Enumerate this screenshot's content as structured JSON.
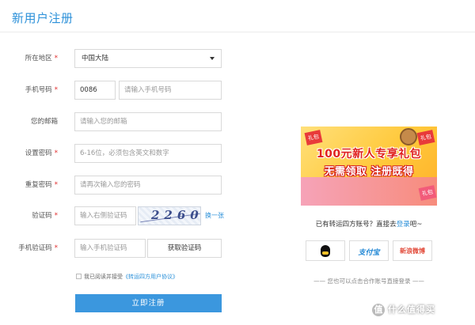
{
  "page": {
    "title": "新用户注册"
  },
  "form": {
    "region": {
      "label": "所在地区",
      "value": "中国大陆"
    },
    "phone": {
      "label": "手机号码",
      "code": "0086",
      "placeholder": "请输入手机号码"
    },
    "email": {
      "label": "您的邮箱",
      "placeholder": "请输入您的邮箱"
    },
    "password": {
      "label": "设置密码",
      "placeholder": "6-16位，必须包含英文和数字"
    },
    "repeat_password": {
      "label": "重复密码",
      "placeholder": "请再次输入您的密码"
    },
    "captcha": {
      "label": "验证码",
      "placeholder": "输入右侧验证码",
      "image_text": "2260",
      "refresh": "换一张"
    },
    "sms_code": {
      "label": "手机验证码",
      "placeholder": "输入手机验证码",
      "button": "获取验证码"
    },
    "agreement": {
      "prefix": "我已阅读并接受",
      "link": "《转运四方用户协议》"
    },
    "submit": "立即注册",
    "required_mark": "*"
  },
  "promo": {
    "line1": "100元新人专享礼包",
    "line2": "无需领取 注册既得",
    "badge": "礼包"
  },
  "login": {
    "prefix": "已有转运四方账号？直接去",
    "link": "登录",
    "suffix": "吧~"
  },
  "social": {
    "alipay": "支付宝",
    "weibo": "新浪微博"
  },
  "alt_login": "—— 您也可以点击合作账号直接登录 ——",
  "watermark": "什么值得买",
  "watermark_icon": "值",
  "colors": {
    "accent": "#2b90d9",
    "submit_bg": "#3b97de",
    "required": "#e02a2a"
  }
}
